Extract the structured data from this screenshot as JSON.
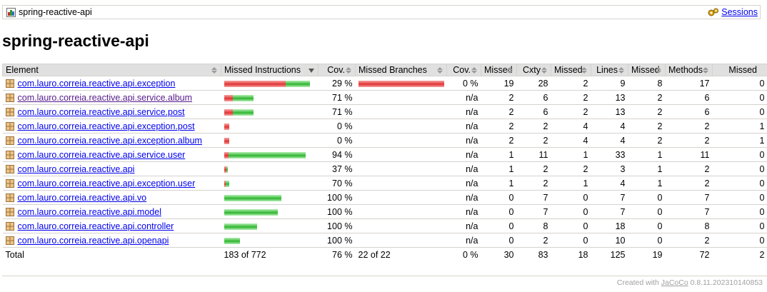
{
  "breadcrumb": {
    "report_name": "spring-reactive-api",
    "sessions_label": "Sessions"
  },
  "page_title": "spring-reactive-api",
  "table": {
    "headers": [
      "Element",
      "Missed Instructions",
      "Cov.",
      "Missed Branches",
      "Cov.",
      "Missed",
      "Cxty",
      "Missed",
      "Lines",
      "Missed",
      "Methods",
      "Missed"
    ],
    "rows": [
      {
        "name": "com.lauro.correia.reactive.api.exception",
        "red": 86,
        "green": 34,
        "cov": "29 %",
        "bred": 120,
        "bgreen": 0,
        "bcov": "0 %",
        "mcx": "19",
        "cx": "28",
        "ml": "2",
        "l": "9",
        "mm": "8",
        "m": "17",
        "mc": "0",
        "visited": false
      },
      {
        "name": "com.lauro.correia.reactive.api.service.album",
        "red": 12,
        "green": 29,
        "cov": "71 %",
        "bred": 0,
        "bgreen": 0,
        "bcov": "n/a",
        "mcx": "2",
        "cx": "6",
        "ml": "2",
        "l": "13",
        "mm": "2",
        "m": "6",
        "mc": "0",
        "visited": true
      },
      {
        "name": "com.lauro.correia.reactive.api.service.post",
        "red": 12,
        "green": 29,
        "cov": "71 %",
        "bred": 0,
        "bgreen": 0,
        "bcov": "n/a",
        "mcx": "2",
        "cx": "6",
        "ml": "2",
        "l": "13",
        "mm": "2",
        "m": "6",
        "mc": "0",
        "visited": false
      },
      {
        "name": "com.lauro.correia.reactive.api.exception.post",
        "red": 7,
        "green": 0,
        "cov": "0 %",
        "bred": 0,
        "bgreen": 0,
        "bcov": "n/a",
        "mcx": "2",
        "cx": "2",
        "ml": "4",
        "l": "4",
        "mm": "2",
        "m": "2",
        "mc": "1",
        "visited": false
      },
      {
        "name": "com.lauro.correia.reactive.api.exception.album",
        "red": 7,
        "green": 0,
        "cov": "0 %",
        "bred": 0,
        "bgreen": 0,
        "bcov": "n/a",
        "mcx": "2",
        "cx": "2",
        "ml": "4",
        "l": "4",
        "mm": "2",
        "m": "2",
        "mc": "1",
        "visited": false
      },
      {
        "name": "com.lauro.correia.reactive.api.service.user",
        "red": 6,
        "green": 108,
        "cov": "94 %",
        "bred": 0,
        "bgreen": 0,
        "bcov": "n/a",
        "mcx": "1",
        "cx": "11",
        "ml": "1",
        "l": "33",
        "mm": "1",
        "m": "11",
        "mc": "0",
        "visited": false
      },
      {
        "name": "com.lauro.correia.reactive.api",
        "red": 3,
        "green": 2,
        "cov": "37 %",
        "bred": 0,
        "bgreen": 0,
        "bcov": "n/a",
        "mcx": "1",
        "cx": "2",
        "ml": "2",
        "l": "3",
        "mm": "1",
        "m": "2",
        "mc": "0",
        "visited": false
      },
      {
        "name": "com.lauro.correia.reactive.api.exception.user",
        "red": 2,
        "green": 5,
        "cov": "70 %",
        "bred": 0,
        "bgreen": 0,
        "bcov": "n/a",
        "mcx": "1",
        "cx": "2",
        "ml": "1",
        "l": "4",
        "mm": "1",
        "m": "2",
        "mc": "0",
        "visited": false
      },
      {
        "name": "com.lauro.correia.reactive.api.vo",
        "red": 0,
        "green": 80,
        "cov": "100 %",
        "bred": 0,
        "bgreen": 0,
        "bcov": "n/a",
        "mcx": "0",
        "cx": "7",
        "ml": "0",
        "l": "7",
        "mm": "0",
        "m": "7",
        "mc": "0",
        "visited": false
      },
      {
        "name": "com.lauro.correia.reactive.api.model",
        "red": 0,
        "green": 75,
        "cov": "100 %",
        "bred": 0,
        "bgreen": 0,
        "bcov": "n/a",
        "mcx": "0",
        "cx": "7",
        "ml": "0",
        "l": "7",
        "mm": "0",
        "m": "7",
        "mc": "0",
        "visited": false
      },
      {
        "name": "com.lauro.correia.reactive.api.controller",
        "red": 0,
        "green": 46,
        "cov": "100 %",
        "bred": 0,
        "bgreen": 0,
        "bcov": "n/a",
        "mcx": "0",
        "cx": "8",
        "ml": "0",
        "l": "18",
        "mm": "0",
        "m": "8",
        "mc": "0",
        "visited": false
      },
      {
        "name": "com.lauro.correia.reactive.api.openapi",
        "red": 0,
        "green": 22,
        "cov": "100 %",
        "bred": 0,
        "bgreen": 0,
        "bcov": "n/a",
        "mcx": "0",
        "cx": "2",
        "ml": "0",
        "l": "10",
        "mm": "0",
        "m": "2",
        "mc": "0",
        "visited": false
      }
    ],
    "total": {
      "label": "Total",
      "mi": "183 of 772",
      "cov": "76 %",
      "mb": "22 of 22",
      "bcov": "0 %",
      "mcx": "30",
      "cx": "83",
      "ml": "18",
      "l": "125",
      "mm": "19",
      "m": "72",
      "mc": "2"
    }
  },
  "footer": {
    "prefix": "Created with ",
    "link": "JaCoCo",
    "suffix": " 0.8.11.202310140853"
  }
}
